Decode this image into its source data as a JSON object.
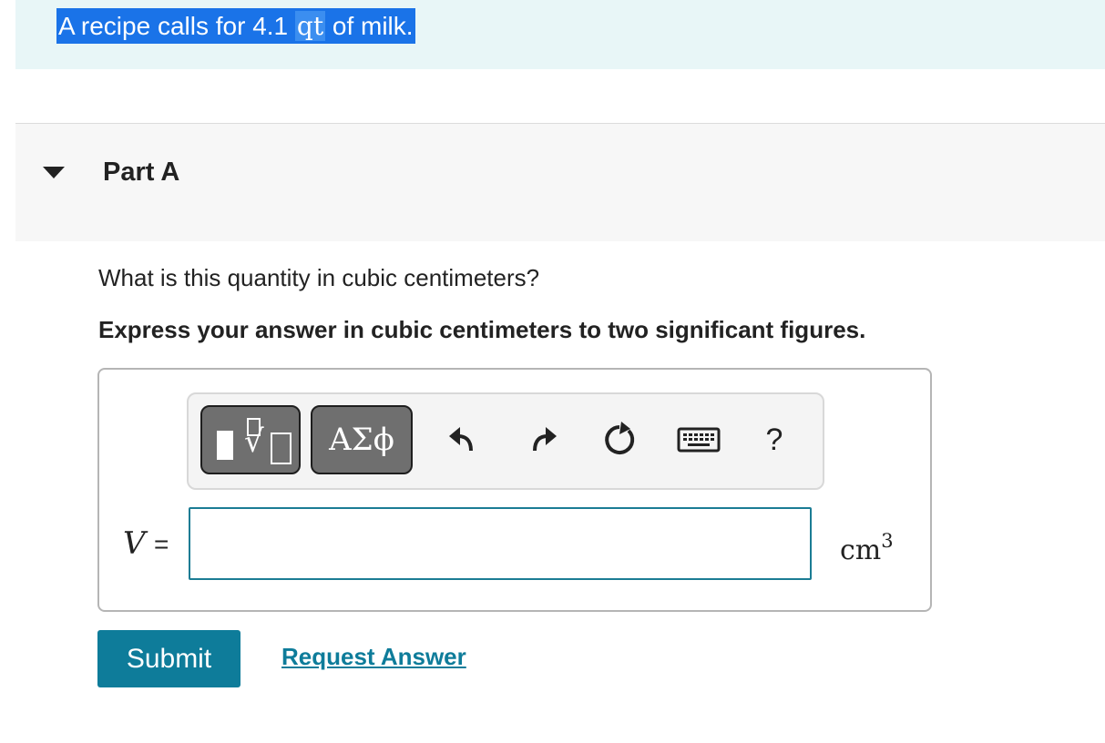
{
  "intro": {
    "text_before": "A recipe calls for 4.1 ",
    "unit": "qt",
    "text_after": " of milk."
  },
  "part": {
    "title": "Part A",
    "expanded": true
  },
  "question": "What is this quantity in cubic centimeters?",
  "instruction": "Express your answer in cubic centimeters to two significant figures.",
  "toolbar": {
    "templates_icon": "templates-radical-icon",
    "symbols_label": "ΑΣϕ",
    "undo_icon": "undo-icon",
    "redo_icon": "redo-icon",
    "reset_icon": "reset-icon",
    "keyboard_icon": "keyboard-icon",
    "help_label": "?"
  },
  "answer": {
    "variable": "V",
    "equals": "=",
    "value": "",
    "unit_base": "cm",
    "unit_exp": "3"
  },
  "actions": {
    "submit_label": "Submit",
    "request_label": "Request Answer"
  },
  "colors": {
    "accent": "#0e7c9a",
    "selection": "#1a73e8",
    "intro_bg": "#e8f6f7",
    "button_gray": "#6f6f6f"
  }
}
